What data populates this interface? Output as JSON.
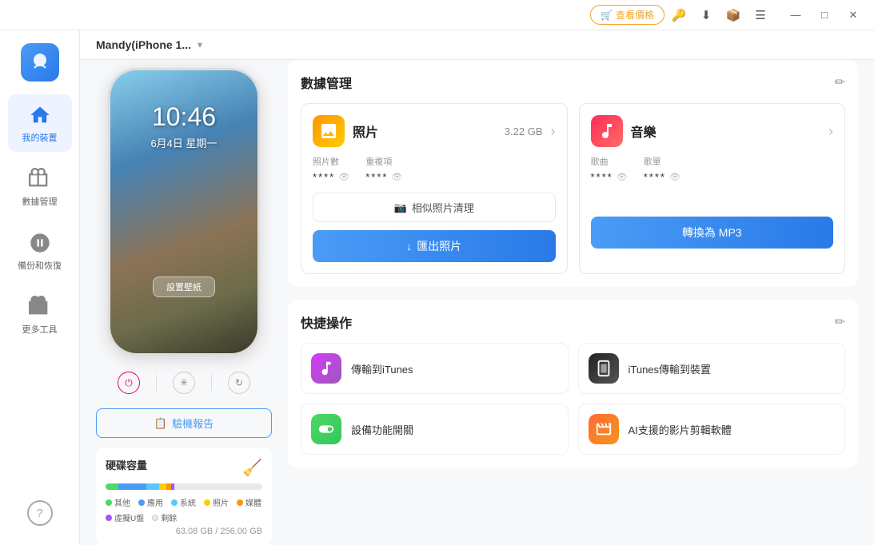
{
  "titlebar": {
    "price_btn": "查看價格",
    "icons": [
      "key",
      "download",
      "box",
      "menu"
    ]
  },
  "sidebar": {
    "logo_alt": "app logo",
    "items": [
      {
        "id": "my-device",
        "label": "我的裝置",
        "active": true
      },
      {
        "id": "data-mgmt",
        "label": "數據管理",
        "active": false
      },
      {
        "id": "backup",
        "label": "備份和恢復",
        "active": false
      },
      {
        "id": "more-tools",
        "label": "更多工具",
        "active": false
      }
    ],
    "help_label": "?"
  },
  "device": {
    "name": "Mandy(iPhone 1...",
    "dropdown_arrow": "▾",
    "time": "10:46",
    "date": "6月4日 星期一",
    "wallpaper_btn": "設置壁紙",
    "diagnostic_btn": "驗機報告",
    "storage": {
      "title": "硬碟容量",
      "total": "63.08 GB / 256.00 GB",
      "segments": [
        {
          "label": "其他",
          "color": "#4cd964",
          "percent": 8
        },
        {
          "label": "應用",
          "color": "#4a9cf6",
          "percent": 18
        },
        {
          "label": "系統",
          "color": "#5ac8fa",
          "percent": 8
        },
        {
          "label": "照片",
          "color": "#ffcc00",
          "percent": 5
        },
        {
          "label": "媒體",
          "color": "#ff9500",
          "percent": 3
        },
        {
          "label": "虛擬U盤",
          "color": "#a855f7",
          "percent": 2
        },
        {
          "label": "剩餘",
          "color": "#e8e8e8",
          "percent": 56
        }
      ]
    }
  },
  "data_management": {
    "title": "數據管理",
    "edit_icon": "✏",
    "photos_card": {
      "title": "照片",
      "size": "3.22 GB",
      "icon": "🖼",
      "stat1_label": "照片數",
      "stat1_value": "****",
      "stat2_label": "重複項",
      "stat2_value": "****",
      "similar_btn": "相似照片清理",
      "export_btn": "匯出照片",
      "export_icon": "↓"
    },
    "music_card": {
      "title": "音樂",
      "icon": "♪",
      "stat1_label": "歌曲",
      "stat1_value": "****",
      "stat2_label": "歌單",
      "stat2_value": "****",
      "convert_btn": "轉換為 MP3"
    }
  },
  "quick_actions": {
    "title": "快捷操作",
    "edit_icon": "✏",
    "items": [
      {
        "id": "itunes-send",
        "label": "傳輸到iTunes",
        "icon_type": "itunes-send"
      },
      {
        "id": "itunes-recv",
        "label": "iTunes傳輸到裝置",
        "icon_type": "itunes-recv"
      },
      {
        "id": "settings",
        "label": "設備功能開關",
        "icon_type": "settings"
      },
      {
        "id": "ai-video",
        "label": "AI支援的影片剪輯軟體",
        "icon_type": "ai-video"
      }
    ]
  }
}
